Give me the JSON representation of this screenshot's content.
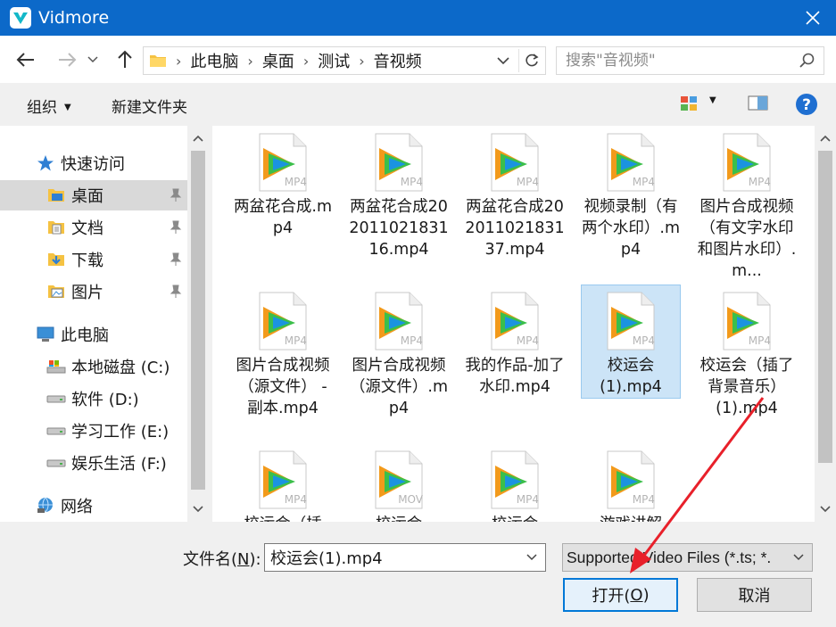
{
  "window": {
    "title": "Vidmore",
    "accent": "#0c69c9"
  },
  "address": {
    "crumbs": [
      "此电脑",
      "桌面",
      "测试",
      "音视频"
    ],
    "search_placeholder": "搜索\"音视频\""
  },
  "toolbar": {
    "organize": "组织",
    "new_folder": "新建文件夹"
  },
  "nav": {
    "quick_access": "快速访问",
    "desktop": "桌面",
    "documents": "文档",
    "downloads": "下载",
    "pictures": "图片",
    "this_pc": "此电脑",
    "drive_c": "本地磁盘 (C:)",
    "drive_d": "软件 (D:)",
    "drive_e": "学习工作 (E:)",
    "drive_f": "娱乐生活 (F:)",
    "network": "网络"
  },
  "files": [
    {
      "name": "两盆花合成.mp4",
      "badge": "MP4"
    },
    {
      "name": "两盆花合成20201102183116.mp4",
      "badge": "MP4"
    },
    {
      "name": "两盆花合成20201102183137.mp4",
      "badge": "MP4"
    },
    {
      "name": "视频录制（有两个水印）.mp4",
      "badge": "MP4"
    },
    {
      "name": "图片合成视频（有文字水印和图片水印）.m...",
      "badge": "MP4"
    },
    {
      "name": "图片合成视频（源文件） - 副本.mp4",
      "badge": "MP4"
    },
    {
      "name": "图片合成视频（源文件）.mp4",
      "badge": "MP4"
    },
    {
      "name": "我的作品-加了水印.mp4",
      "badge": "MP4"
    },
    {
      "name": "校运会(1).mp4",
      "badge": "MP4"
    },
    {
      "name": "校运会（插了背景音乐）(1).mp4",
      "badge": "MP4"
    },
    {
      "name": "校运会（插",
      "badge": "MP4"
    },
    {
      "name": "校运会",
      "badge": "MOV"
    },
    {
      "name": "校运会",
      "badge": "MP4"
    },
    {
      "name": "游戏讲解",
      "badge": "MP4"
    }
  ],
  "bottom": {
    "filename_label": "文件名(",
    "filename_key": "N",
    "filename_label_end": "):",
    "filename_value": "校运会(1).mp4",
    "filter_value": "Supported Video Files (*.ts; *.",
    "open_label": "打开(",
    "open_key": "O",
    "open_label_end": ")",
    "cancel_label": "取消"
  }
}
